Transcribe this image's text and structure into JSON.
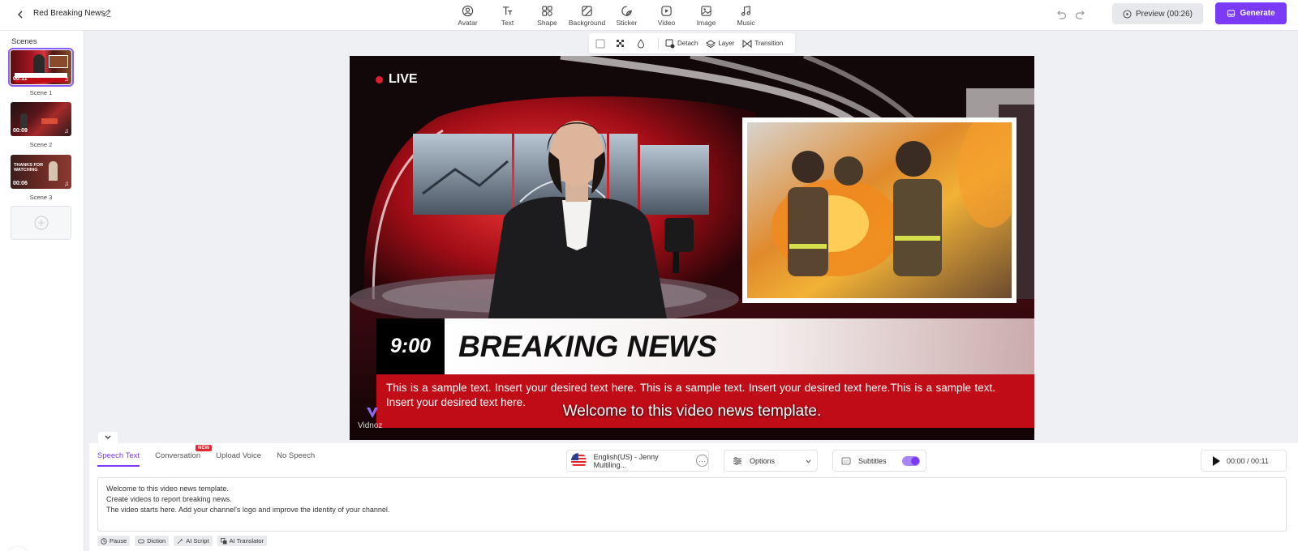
{
  "project": {
    "title": "Red Breaking News"
  },
  "toolbar": {
    "tools": [
      {
        "label": "Avatar",
        "icon": "avatar-icon"
      },
      {
        "label": "Text",
        "icon": "text-icon"
      },
      {
        "label": "Shape",
        "icon": "shape-icon"
      },
      {
        "label": "Background",
        "icon": "background-icon"
      },
      {
        "label": "Sticker",
        "icon": "sticker-icon"
      },
      {
        "label": "Video",
        "icon": "video-icon"
      },
      {
        "label": "Image",
        "icon": "image-icon"
      },
      {
        "label": "Music",
        "icon": "music-icon"
      }
    ],
    "preview_label": "Preview (00:26)",
    "generate_label": "Generate"
  },
  "scenes": {
    "title": "Scenes",
    "items": [
      {
        "label": "Scene 1",
        "duration": "00:11",
        "active": true
      },
      {
        "label": "Scene 2",
        "duration": "00:09",
        "active": false
      },
      {
        "label": "Scene 3",
        "duration": "00:06",
        "active": false
      }
    ]
  },
  "canvas_toolbar": {
    "detach": "Detach",
    "layer": "Layer",
    "transition": "Transition"
  },
  "stage": {
    "live": "LIVE",
    "time": "9:00",
    "headline": "BREAKING NEWS",
    "ticker": "This is a sample text. Insert your desired text here. This is a sample text. Insert your desired text here.This is a sample text. Insert your desired text here.",
    "subtitle": "Welcome to this video news template.",
    "watermark": "Vidnoz"
  },
  "speech": {
    "tabs": [
      {
        "label": "Speech Text",
        "active": true
      },
      {
        "label": "Conversation",
        "badge": "NEW"
      },
      {
        "label": "Upload Voice"
      },
      {
        "label": "No Speech"
      }
    ],
    "voice": "English(US) - Jenny Multiling...",
    "options_label": "Options",
    "subtitles_label": "Subtitles",
    "subtitles_on": true,
    "time": "00:00 / 00:11",
    "lines": [
      "Welcome to this video news template.",
      "Create videos to report breaking news.",
      "The video starts here. Add your channel's logo and improve the identity of your channel."
    ],
    "chips": [
      "Pause",
      "Diction",
      "AI Script",
      "AI Translator"
    ]
  },
  "colors": {
    "accent": "#7b3af5",
    "news_red": "#c00c17"
  }
}
